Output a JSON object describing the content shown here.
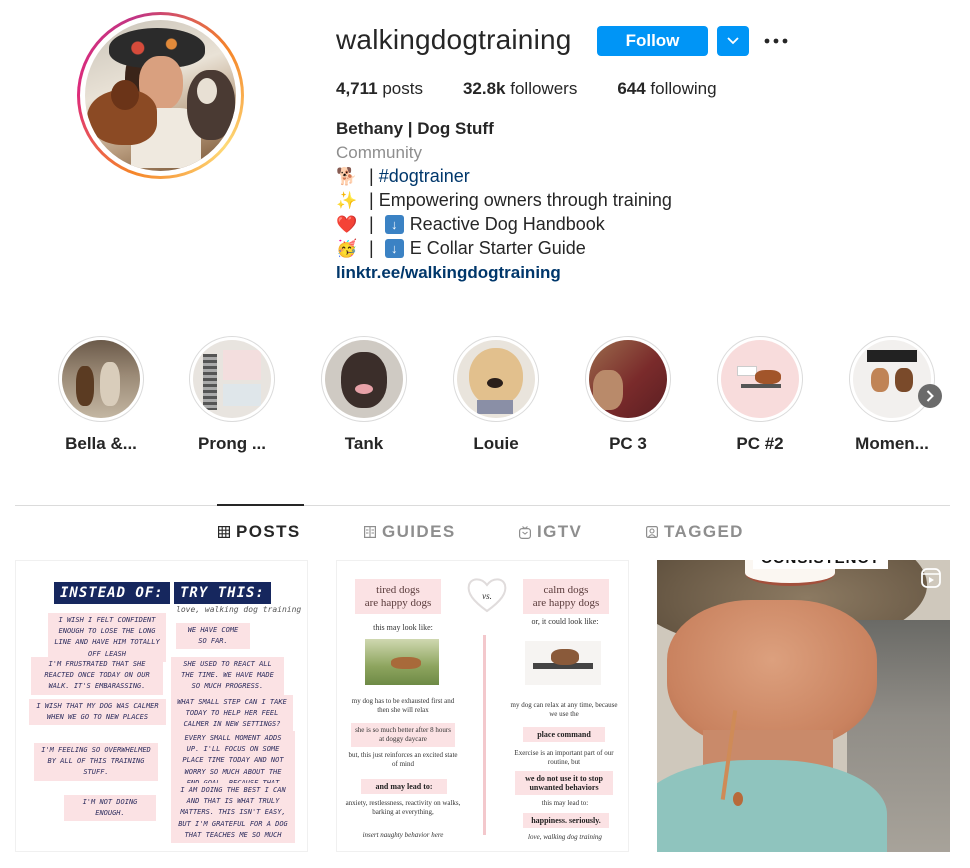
{
  "profile": {
    "username": "walkingdogtraining",
    "follow_label": "Follow",
    "stats": {
      "posts": "4,711",
      "posts_label": " posts",
      "followers": "32.8k",
      "followers_label": " followers",
      "following": "644",
      "following_label": " following"
    },
    "full_name": "Bethany | Dog Stuff",
    "category": "Community",
    "bio": [
      {
        "emoji": "🐕",
        "sep": " | ",
        "text": "#dogtrainer"
      },
      {
        "emoji": "✨",
        "sep": " | ",
        "text": "Empowering owners through training"
      },
      {
        "emoji": "❤️",
        "sep": " | ",
        "text": "Reactive Dog Handbook"
      },
      {
        "emoji": "🥳",
        "sep": " | ",
        "text": "E Collar Starter Guide"
      }
    ],
    "link": "linktr.ee/walkingdogtraining"
  },
  "highlights": [
    "Bella &...",
    "Prong ...",
    "Tank",
    "Louie",
    "PC 3",
    "PC #2",
    "Momen..."
  ],
  "tabs": [
    {
      "label": "POSTS",
      "active": true
    },
    {
      "label": "GUIDES"
    },
    {
      "label": "IGTV"
    },
    {
      "label": "TAGGED"
    }
  ],
  "posts": {
    "p1": {
      "header_left": "INSTEAD OF:",
      "header_right": "TRY THIS:",
      "signature": "love, walking dog training",
      "left": [
        "I WISH I FELT CONFIDENT ENOUGH TO LOSE THE LONG LINE AND HAVE HIM TOTALLY OFF LEASH",
        "I'M FRUSTRATED THAT SHE REACTED ONCE TODAY ON OUR WALK. IT'S EMBARASSING.",
        "I WISH THAT MY DOG WAS CALMER WHEN WE GO TO NEW PLACES",
        "I'M FEELING SO OVERWHELMED BY ALL OF THIS TRAINING STUFF.",
        "I'M NOT DOING ENOUGH."
      ],
      "right": [
        "WE HAVE COME SO FAR.",
        "SHE USED TO REACT ALL THE TIME. WE HAVE MADE SO MUCH PROGRESS.",
        "WHAT SMALL STEP CAN I TAKE TODAY TO HELP HER FEEL CALMER IN NEW SETTINGS?",
        "EVERY SMALL MOMENT ADDS UP. I'LL FOCUS ON SOME PLACE TIME TODAY AND NOT WORRY SO MUCH ABOUT THE END GOAL, BECAUSE THAT OVERWHELMS ME.",
        "I AM DOING THE BEST I CAN AND THAT IS WHAT TRULY MATTERS. THIS ISN'T EASY, BUT I'M GRATEFUL FOR A DOG THAT TEACHES ME SO MUCH"
      ]
    },
    "p2": {
      "left_title": "tired dogs\nare happy dogs",
      "vs": "vs.",
      "right_title": "calm dogs\nare happy dogs",
      "left": {
        "look": "this may look like:",
        "l1": "my dog has to be exhausted first and then she will relax",
        "l2": "she is so much better after 8 hours at doggy daycare",
        "l3": "but, this just reinforces an excited state of mind",
        "lead": "and may lead to:",
        "l4": "anxiety, restlessness, reactivity on walks, barking at everything,",
        "l5": "insert naughty behavior here"
      },
      "right": {
        "look": "or, it could look like:",
        "r1": "my dog can relax at any time, because we use the",
        "r2": "place command",
        "r3": "Exercise is an important part of our routine, but",
        "r4": "we do not use it to stop unwanted behaviors",
        "lead": "this may lead to:",
        "r5": "happiness. seriously.",
        "sig": "love, walking dog training"
      }
    },
    "p3": {
      "overlay_text": "CONSISTENCY"
    }
  }
}
